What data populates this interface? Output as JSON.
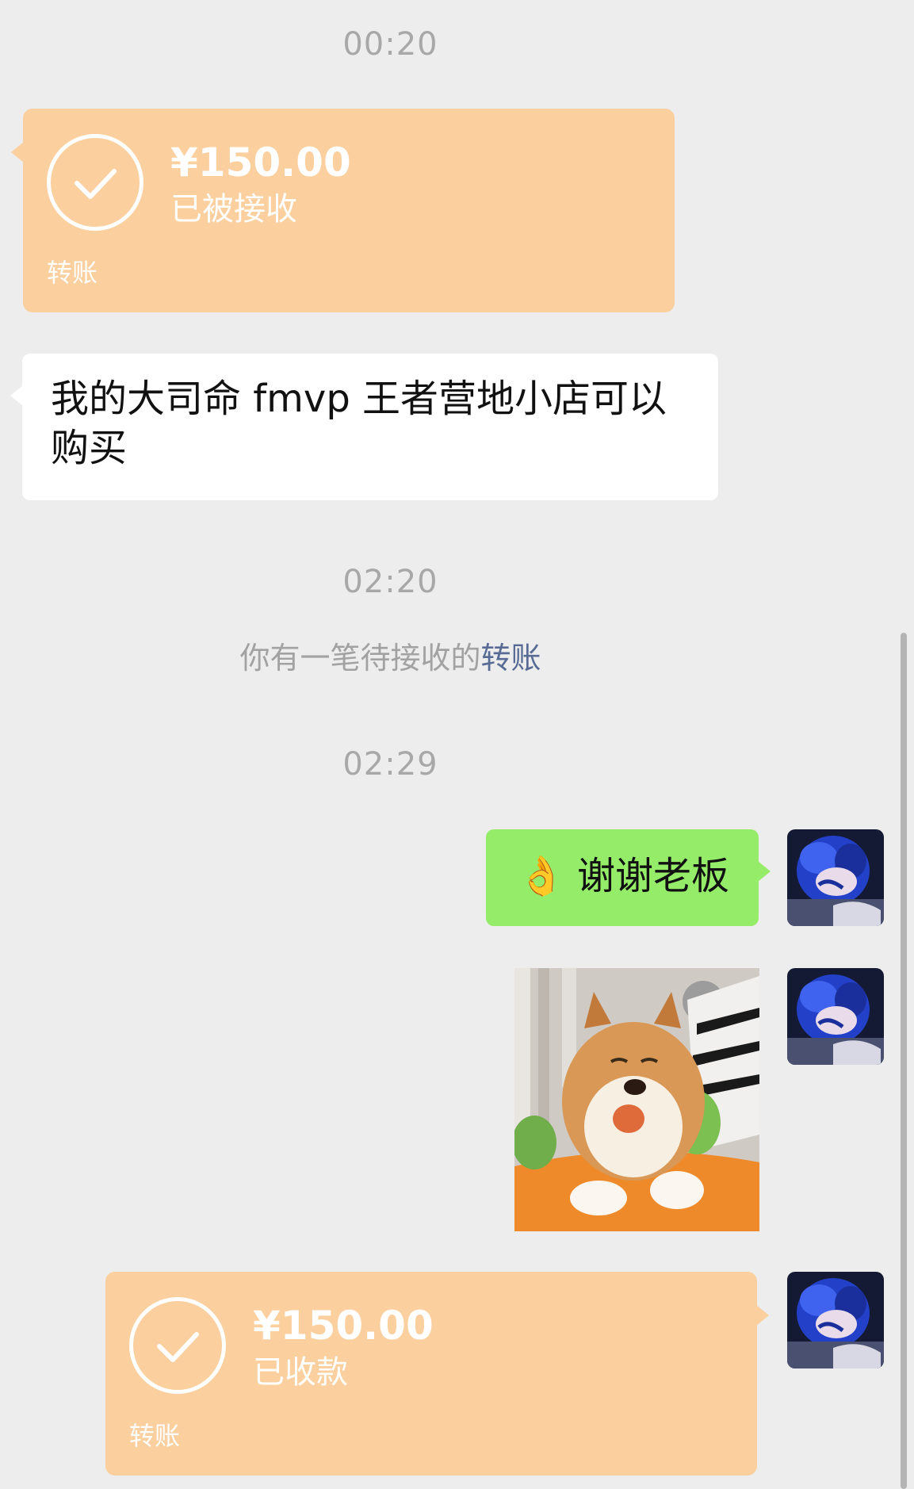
{
  "chat": {
    "timestamps": [
      "00:20",
      "02:20",
      "02:29"
    ],
    "incoming_transfer": {
      "amount": "¥150.00",
      "status": "已被接收",
      "label": "转账"
    },
    "incoming_text": {
      "line1": "我的大司命 fmvp  王者营地小店可以",
      "line2": "购买"
    },
    "system_notice": {
      "prefix": "你有一笔待接收的",
      "link": "转账"
    },
    "outgoing_text": {
      "emoji": "👌",
      "text": "谢谢老板"
    },
    "sticker": {
      "icon": "shiba-dog-sticker"
    },
    "outgoing_transfer": {
      "amount": "¥150.00",
      "status": "已收款",
      "label": "转账"
    },
    "avatar": {
      "icon": "anime-avatar"
    }
  },
  "colors": {
    "background": "#ededed",
    "transfer": "#fbcf9e",
    "green_bubble": "#95ec69",
    "link": "#576b95"
  }
}
